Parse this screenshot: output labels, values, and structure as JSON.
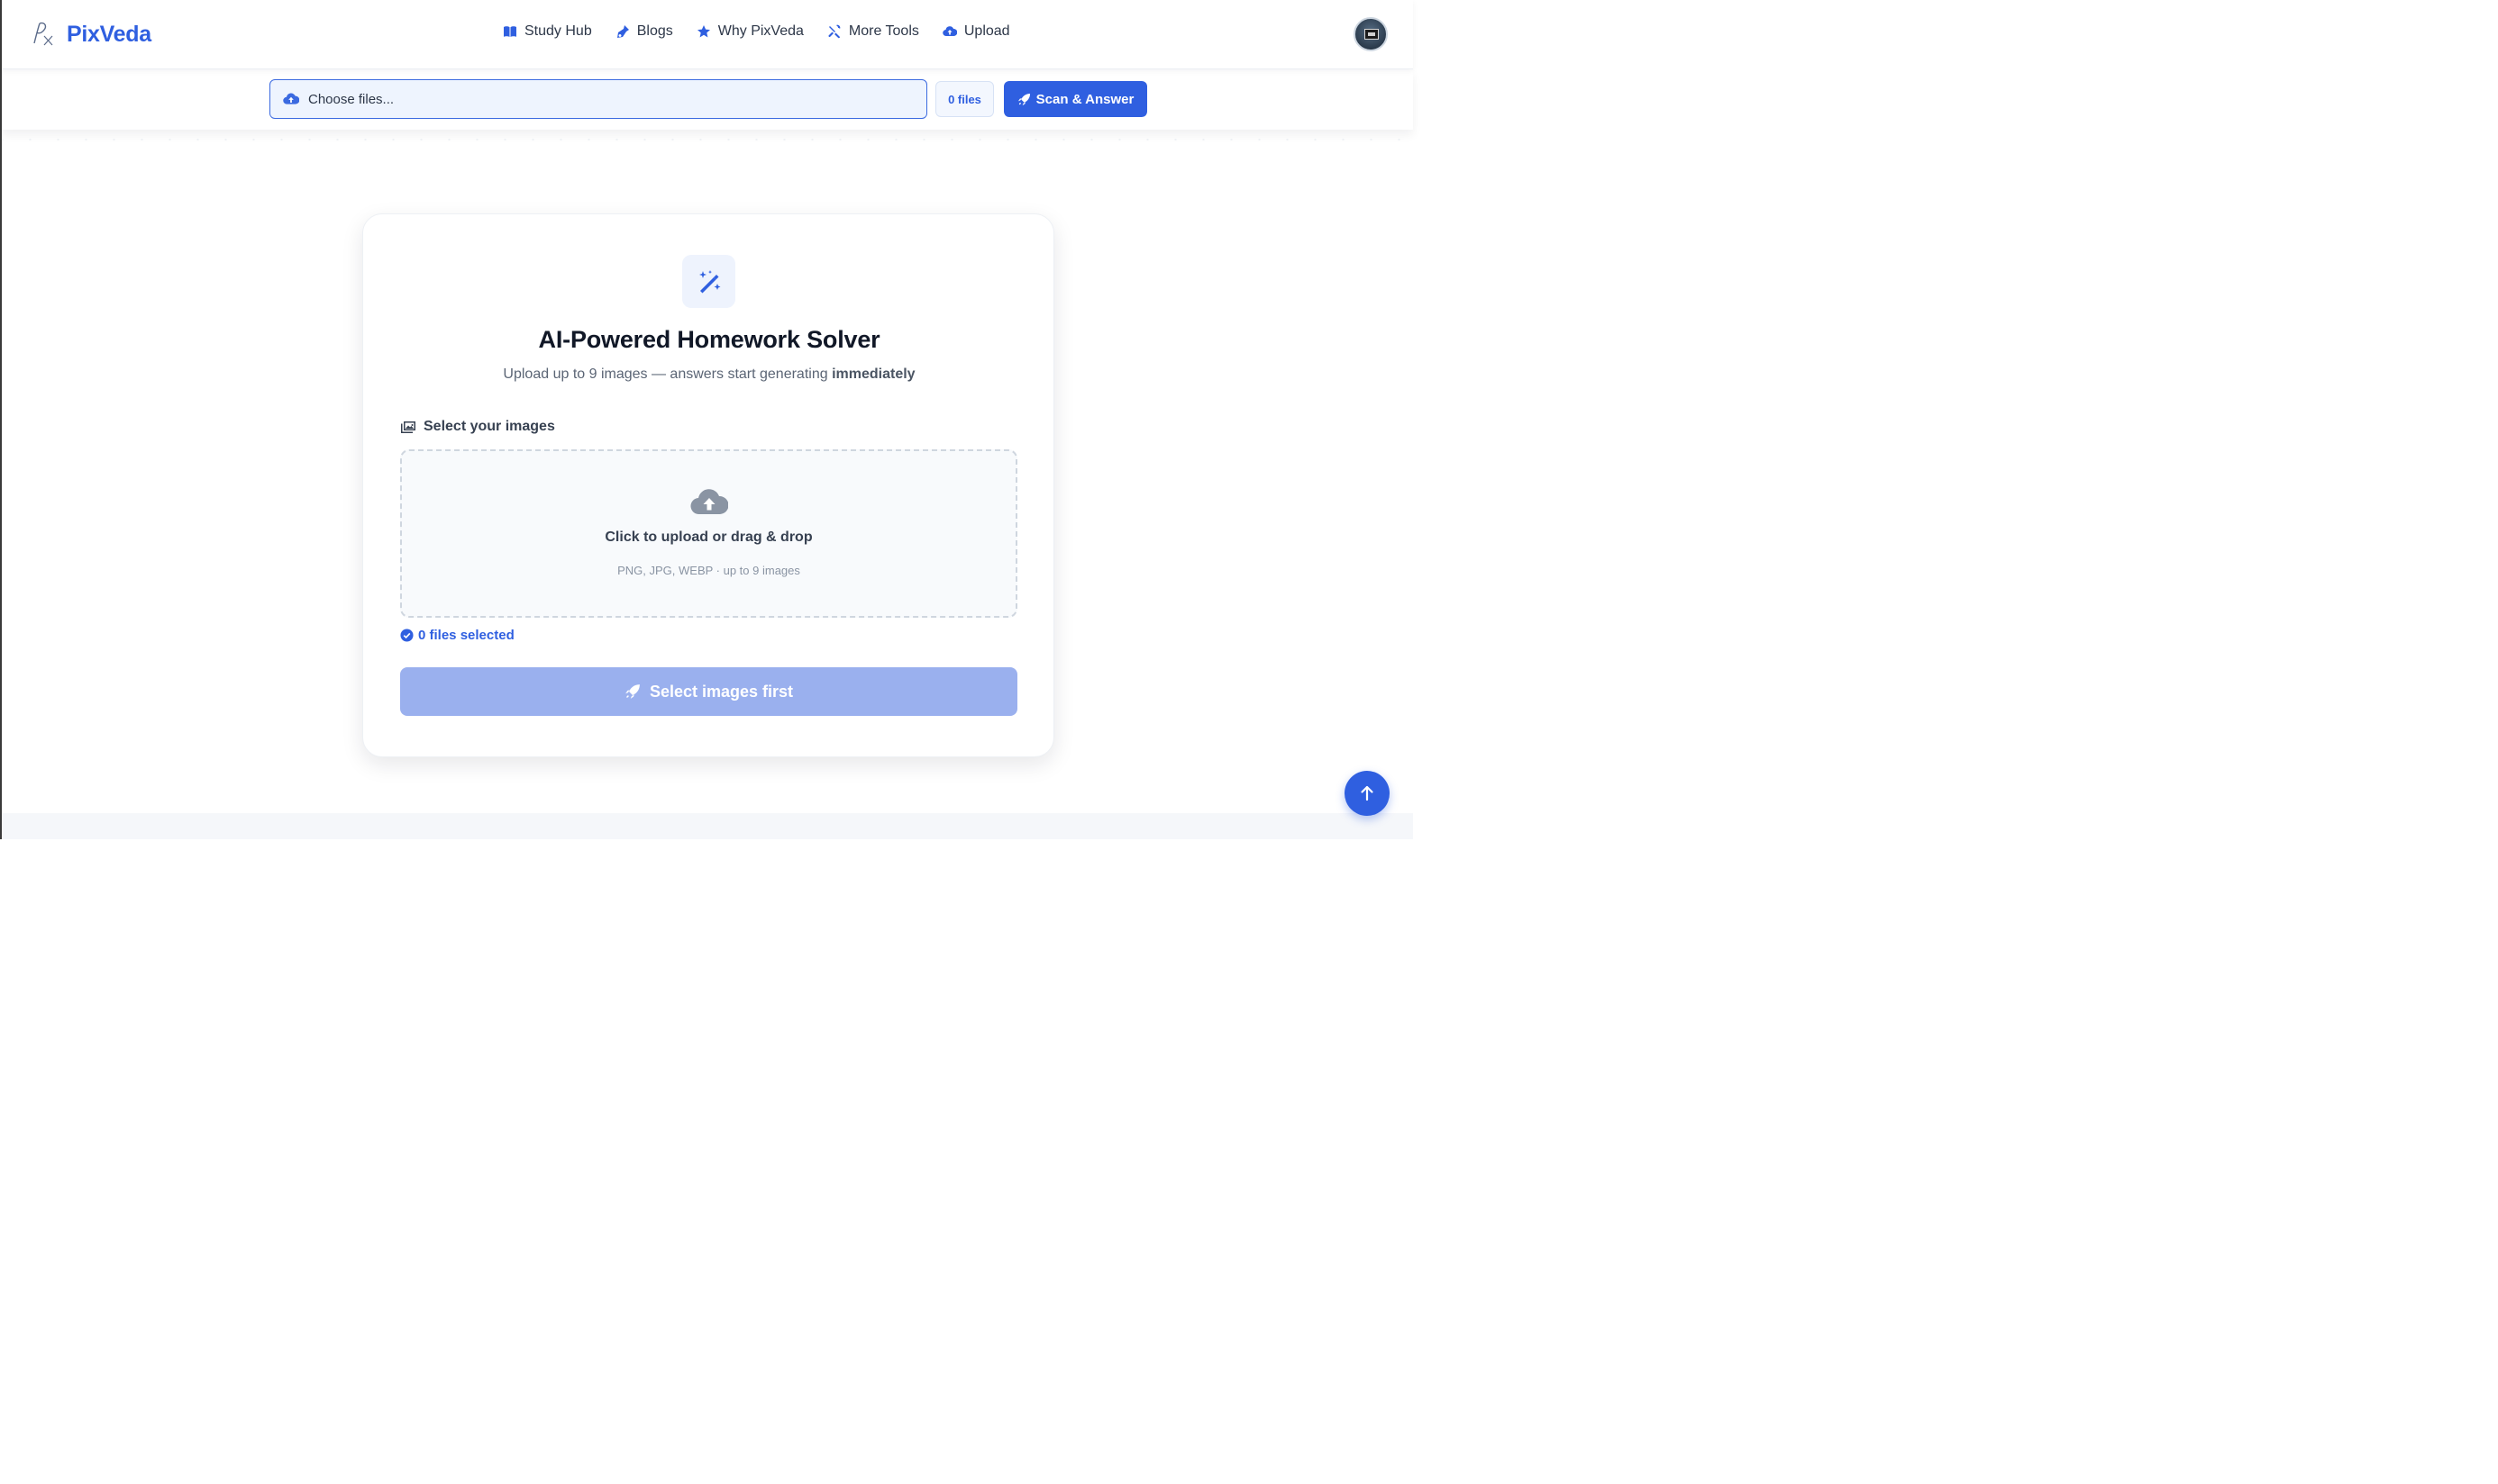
{
  "brand": {
    "name": "PixVeda",
    "logo_icon": "px-script-logo-icon"
  },
  "nav": {
    "items": [
      {
        "label": "Study Hub",
        "icon": "book-open-icon"
      },
      {
        "label": "Blogs",
        "icon": "pen-nib-icon"
      },
      {
        "label": "Why PixVeda",
        "icon": "star-icon"
      },
      {
        "label": "More Tools",
        "icon": "tools-icon"
      },
      {
        "label": "Upload",
        "icon": "cloud-upload-icon"
      }
    ]
  },
  "upload_bar": {
    "choose_label": "Choose files...",
    "files_count": "0 files",
    "scan_label": "Scan & Answer"
  },
  "card": {
    "icon": "magic-wand-icon",
    "title": "AI-Powered Homework Solver",
    "subtitle_prefix": "Upload up to 9 images — answers start generating",
    "subtitle_emphasis": "immediately",
    "select_label": "Select your images",
    "dropzone_main": "Click to upload or drag & drop",
    "dropzone_sub": "PNG, JPG, WEBP · up to 9 images",
    "selected_text": "0 files selected",
    "submit_label": "Select images first"
  },
  "colors": {
    "accent": "#2f5fe0",
    "disabled_button": "#9ab0ee",
    "title_text": "#111827"
  }
}
